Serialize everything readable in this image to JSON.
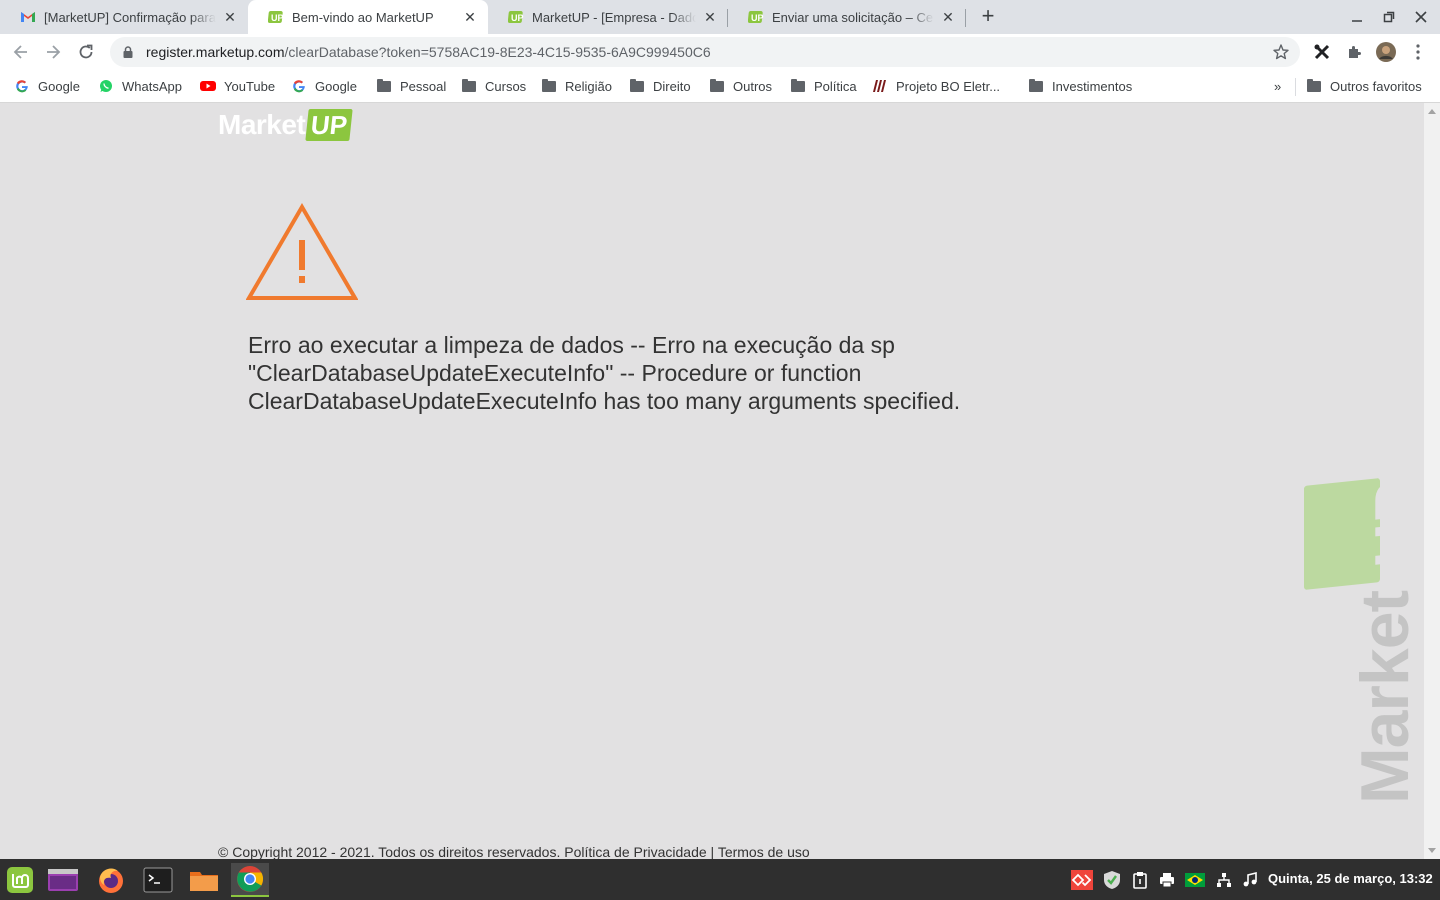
{
  "browser": {
    "tabs": [
      {
        "title": "[MarketUP] Confirmação para",
        "favicon": "gmail-icon"
      },
      {
        "title": "Bem-vindo ao MarketUP",
        "favicon": "marketup-icon"
      },
      {
        "title": "MarketUP - [Empresa - Dados",
        "favicon": "marketup-icon"
      },
      {
        "title": "Enviar uma solicitação – Centr",
        "favicon": "marketup-icon"
      }
    ],
    "url_host": "register.marketup.com",
    "url_path": "/clearDatabase?token=5758AC19-8E23-4C15-9535-6A9C999450C6",
    "bookmarks": [
      "Google",
      "WhatsApp",
      "YouTube",
      "Google",
      "Pessoal",
      "Cursos",
      "Religião",
      "Direito",
      "Outros",
      "Política",
      "Projeto BO Eletr...",
      "Investimentos"
    ],
    "bookmarks_overflow": "»",
    "other_bookmarks": "Outros favoritos"
  },
  "page": {
    "logo_market": "Market",
    "logo_up": "UP",
    "error_message": "Erro ao executar a limpeza de dados -- Erro na execução da sp \"ClearDatabaseUpdateExecuteInfo\" -- Procedure or function ClearDatabaseUpdateExecuteInfo has too many arguments specified.",
    "watermark_market": "Market",
    "watermark_up": "UP",
    "footer": "© Copyright 2012 - 2021. Todos os direitos reservados. Política de Privacidade | Termos de uso"
  },
  "taskbar": {
    "clock": "Quinta, 25 de março, 13:32"
  },
  "colors": {
    "page_bg": "#e2e1e2",
    "warning_orange": "#f07a2e",
    "marketup_green": "#8cc63f"
  }
}
